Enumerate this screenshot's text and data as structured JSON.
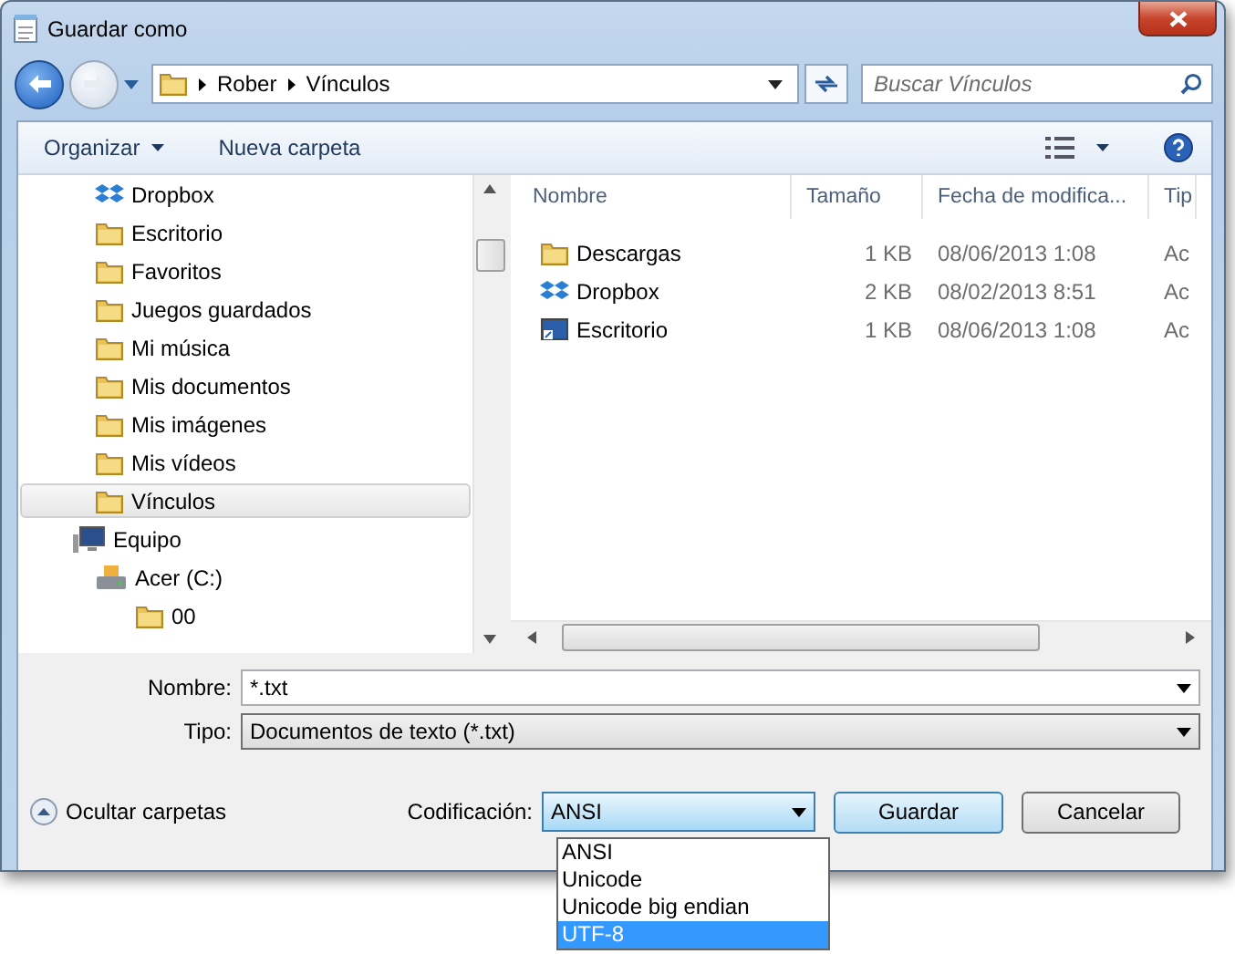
{
  "window": {
    "title": "Guardar como"
  },
  "address": {
    "crumbs": [
      "Rober",
      "Vínculos"
    ]
  },
  "search": {
    "placeholder": "Buscar Vínculos"
  },
  "toolbar": {
    "buttons": [
      "Organizar",
      "Nueva carpeta"
    ]
  },
  "tree": [
    {
      "label": "Dropbox",
      "kind": "dropbox",
      "selected": false
    },
    {
      "label": "Escritorio",
      "kind": "folder",
      "selected": false
    },
    {
      "label": "Favoritos",
      "kind": "folder",
      "selected": false
    },
    {
      "label": "Juegos guardados",
      "kind": "folder",
      "selected": false
    },
    {
      "label": "Mi música",
      "kind": "folder",
      "selected": false
    },
    {
      "label": "Mis documentos",
      "kind": "folder",
      "selected": false
    },
    {
      "label": "Mis imágenes",
      "kind": "folder",
      "selected": false
    },
    {
      "label": "Mis vídeos",
      "kind": "folder",
      "selected": false
    },
    {
      "label": "Vínculos",
      "kind": "folder",
      "selected": true
    },
    {
      "label": "Equipo",
      "kind": "computer",
      "selected": false,
      "children": [
        {
          "label": "Acer (C:)",
          "kind": "drive",
          "selected": false,
          "children": [
            {
              "label": "00",
              "kind": "folder",
              "selected": false
            }
          ]
        }
      ]
    }
  ],
  "table": {
    "columns": [
      "Nombre",
      "Tamaño",
      "Fecha de modifica...",
      "Tip"
    ],
    "rows": [
      {
        "kind": "folder",
        "name": "Descargas",
        "size": "1 KB",
        "date": "08/06/2013 1:08",
        "column_4": "Ac"
      },
      {
        "kind": "dropbox",
        "name": "Dropbox",
        "size": "2 KB",
        "date": "08/02/2013 8:51",
        "column_4": "Ac"
      },
      {
        "kind": "desktop",
        "name": "Escritorio",
        "size": "1 KB",
        "date": "08/06/2013 1:08",
        "column_4": "Ac"
      }
    ]
  },
  "form": {
    "name_label": "Nombre:",
    "name_value": "*.txt",
    "type_label": "Tipo:",
    "type_value": "Documentos de texto (*.txt)"
  },
  "footer": {
    "hide_folders": "Ocultar carpetas",
    "encoding_label": "Codificación:",
    "encoding_value": "ANSI",
    "save": "Guardar",
    "cancel": "Cancelar"
  },
  "encoding_options": [
    {
      "label": "ANSI",
      "selected": false
    },
    {
      "label": "Unicode",
      "selected": false
    },
    {
      "label": "Unicode big endian",
      "selected": false
    },
    {
      "label": "UTF-8",
      "selected": true
    }
  ]
}
